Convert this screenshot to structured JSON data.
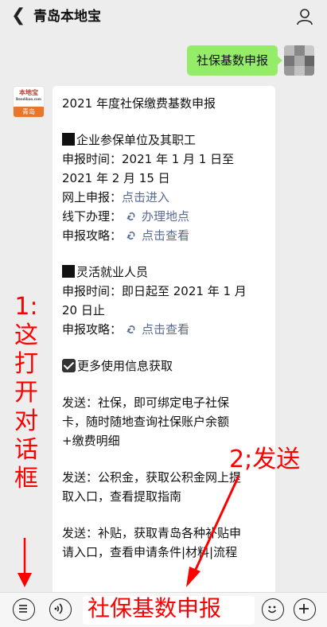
{
  "header": {
    "title": "青岛本地宝"
  },
  "outgoing_message": "社保基数申报",
  "bot_avatar": {
    "logo": "本地宝",
    "logo_sub": "Bendibao.com",
    "city": "青岛"
  },
  "reply": {
    "title": "2021 年度社保缴费基数申报",
    "section1": {
      "heading": "企业参保单位及其职工",
      "time_line1": "申报时间：2021 年 1 月 1 日至",
      "time_line2": "2021 年 2 月 15 日",
      "online_label": "网上申报：",
      "online_link": "点击进入",
      "offline_label": "线下办理：",
      "offline_link": "办理地点",
      "guide_label": "申报攻略：",
      "guide_link": "点击查看"
    },
    "section2": {
      "heading": "灵活就业人员",
      "time_line1": "申报时间：即日起至 2021 年 1 月",
      "time_line2": "20 日止",
      "guide_label": "申报攻略：",
      "guide_link": "点击查看"
    },
    "more": "更多使用信息获取",
    "tip1": {
      "line1": "发送：社保，即可绑定电子社保",
      "line2": "卡，随时随地查询社保账户余额",
      "line3": "+缴费明细"
    },
    "tip2": {
      "line1": "发送：公积金，获取公积金网上提",
      "line2": "取入口，查看提取指南"
    },
    "tip3": {
      "line1": "发送：补贴，获取青岛各种补贴申",
      "line2": "请入口，查看申请条件|材料|流程"
    }
  },
  "annotations": {
    "left_chars": [
      "1:",
      "这",
      "打",
      "开",
      "对",
      "话",
      "框"
    ],
    "right": "2;发送"
  },
  "input": {
    "value": "社保基数申报"
  },
  "icons": [
    "back-icon",
    "person-icon",
    "menu-icon",
    "voice-icon",
    "emoji-icon",
    "plus-icon",
    "link-icon"
  ],
  "colors": {
    "bubble_green": "#95ec69",
    "link_blue": "#576b95",
    "annotation_red": "#ff0000"
  }
}
